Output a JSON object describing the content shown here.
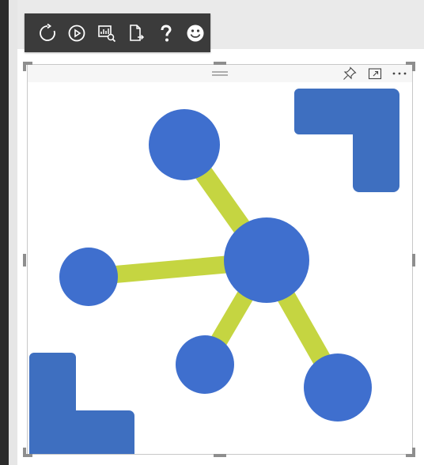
{
  "toolbar": {
    "buttons": [
      {
        "name": "refresh-button",
        "icon": "refresh-icon"
      },
      {
        "name": "play-button",
        "icon": "play-circle-icon"
      },
      {
        "name": "visual-info-button",
        "icon": "chart-info-icon"
      },
      {
        "name": "export-button",
        "icon": "page-export-icon"
      },
      {
        "name": "help-button",
        "icon": "question-icon"
      },
      {
        "name": "feedback-button",
        "icon": "smiley-icon"
      }
    ]
  },
  "visual_header": {
    "drag_handle_icon": "drag-grip-icon",
    "pin_icon": "pin-icon",
    "focus_icon": "focus-mode-icon",
    "more_icon": "more-options-icon"
  },
  "colors": {
    "node_blue": "#3f6fce",
    "edge_green": "#c5d541",
    "corner_blue": "#3e6fc0",
    "toolbar_bg": "#3b3b3b"
  }
}
